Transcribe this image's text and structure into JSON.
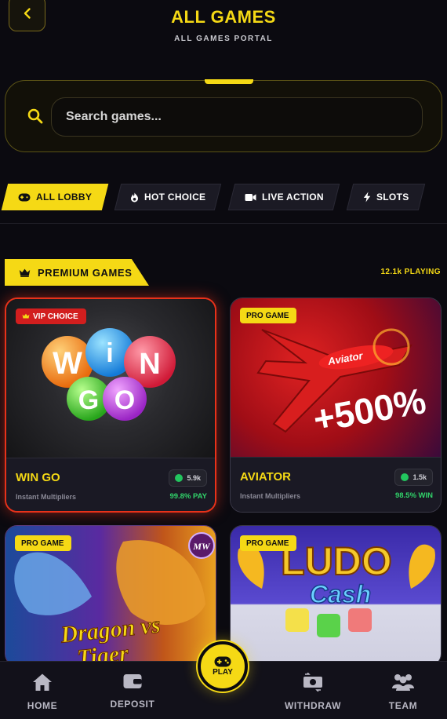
{
  "header": {
    "title": "ALL GAMES",
    "subtitle": "ALL GAMES PORTAL",
    "back_icon": "chevron-left-icon"
  },
  "search": {
    "placeholder": "Search games...",
    "icon": "search-icon"
  },
  "tabs": [
    {
      "label": "ALL LOBBY",
      "icon": "gamepad-icon",
      "active": true
    },
    {
      "label": "HOT CHOICE",
      "icon": "flame-icon",
      "active": false
    },
    {
      "label": "LIVE ACTION",
      "icon": "video-icon",
      "active": false
    },
    {
      "label": "SLOTS",
      "icon": "bolt-icon",
      "active": false
    }
  ],
  "section": {
    "title": "PREMIUM GAMES",
    "icon": "crown-icon",
    "playing": "12.1k PLAYING"
  },
  "games": [
    {
      "name": "WIN GO",
      "badge": "VIP CHOICE",
      "description": "Instant Multipliers",
      "online": "5.9k",
      "payout": "99.8% PAY",
      "art_text_1": "WIN",
      "art_text_2": "GO"
    },
    {
      "name": "AVIATOR",
      "badge": "PRO GAME",
      "description": "Instant Multipliers",
      "online": "1.5k",
      "payout": "98.5% WIN",
      "art_text": "+500%",
      "plane_text": "Aviator"
    },
    {
      "name": "",
      "badge": "PRO GAME",
      "art_text_1": "Dragon vs",
      "art_text_2": "Tiger",
      "logo": "MW"
    },
    {
      "name": "",
      "badge": "PRO GAME",
      "art_text_1": "LUDO",
      "art_text_2": "Cash"
    }
  ],
  "nav": {
    "home": "HOME",
    "deposit": "DEPOSIT",
    "play": "PLAY",
    "withdraw": "WITHDRAW",
    "team": "TEAM"
  },
  "colors": {
    "accent": "#f5d915",
    "background": "#0b0a10",
    "vip": "#d21e1e",
    "success": "#31d36a"
  }
}
